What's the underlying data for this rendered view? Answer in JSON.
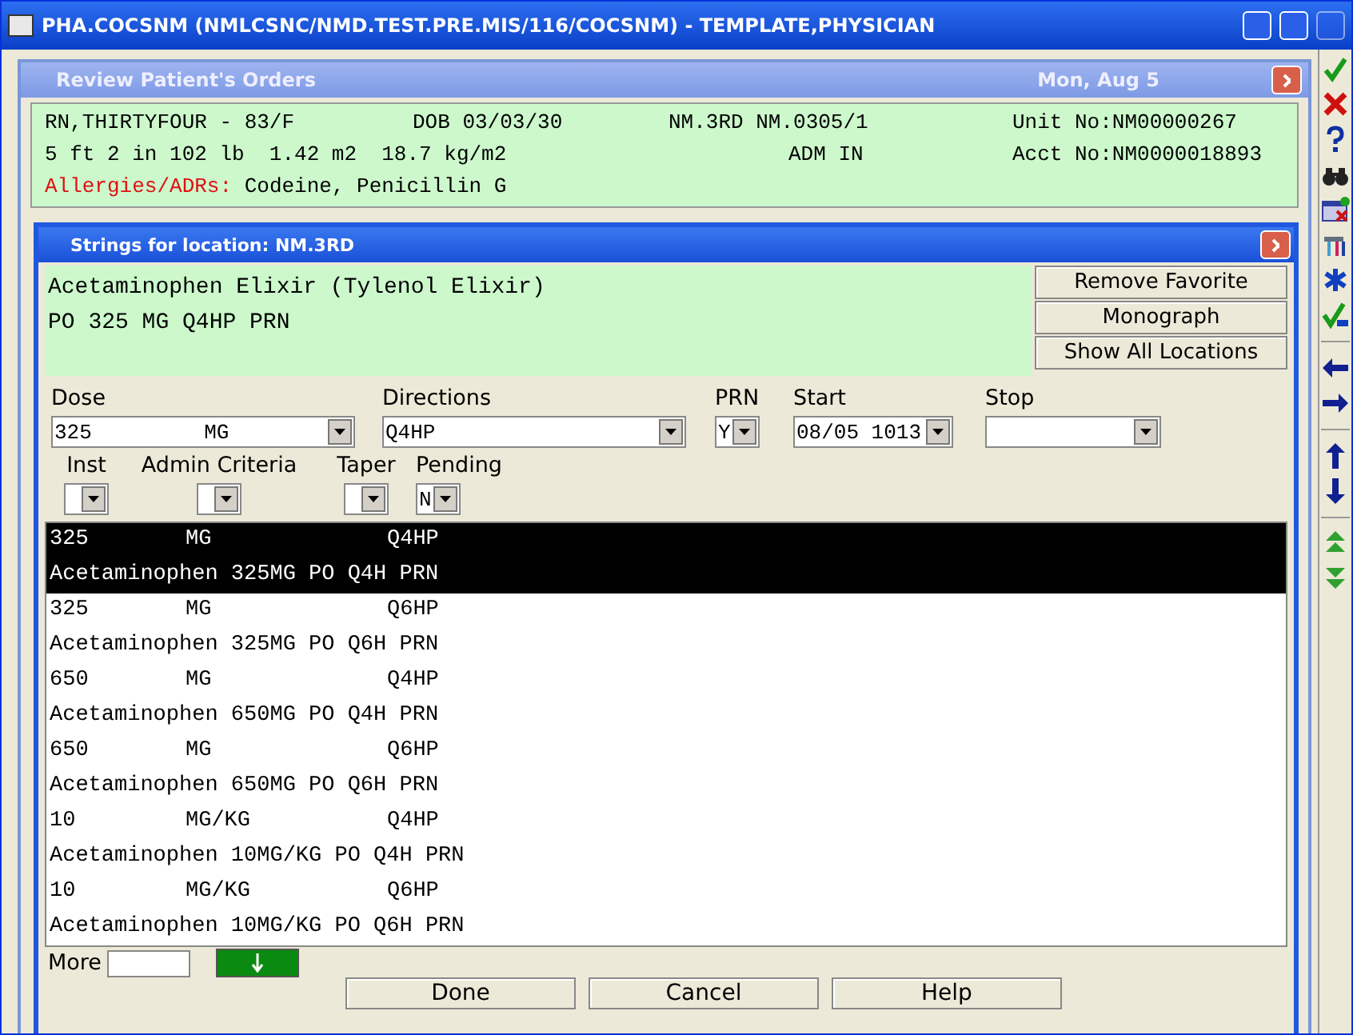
{
  "window": {
    "title": "PHA.COCSNM (NMLCSNC/NMD.TEST.PRE.MIS/116/COCSNM) - TEMPLATE,PHYSICIAN"
  },
  "review": {
    "title": "Review Patient's Orders",
    "date": "Mon, Aug 5",
    "patient": {
      "name": "RN,THIRTYFOUR - 83/F",
      "dob": "DOB 03/03/30",
      "location": "NM.3RD NM.0305/1",
      "unit": "Unit No:NM00000267",
      "measures": "5 ft 2 in 102 lb  1.42 m2  18.7 kg/m2",
      "status": "ADM IN",
      "account": "Acct No:NM0000018893"
    },
    "allergies_label": "Allergies/ADRs:",
    "allergies": "Codeine, Penicillin G"
  },
  "dialog": {
    "title": "Strings for location: NM.3RD",
    "drug_lines": [
      "Acetaminophen Elixir (Tylenol Elixir)",
      "PO 325 MG Q4HP PRN"
    ],
    "side_buttons": [
      "Remove Favorite",
      "Monograph",
      "Show All Locations"
    ],
    "fields_row1": [
      {
        "label": "Dose",
        "value": "325         MG"
      },
      {
        "label": "Directions",
        "value": "Q4HP"
      },
      {
        "label": "PRN",
        "value": "Y"
      },
      {
        "label": "Start",
        "value": "08/05 1013"
      },
      {
        "label": "Stop"
      }
    ],
    "fields_row2": [
      {
        "label": "Inst"
      },
      {
        "label": "Admin Criteria"
      },
      {
        "label": "Taper"
      },
      {
        "label": "Pending",
        "value": "N"
      }
    ],
    "strings": [
      {
        "dose": "325",
        "unit": "MG",
        "directions": "Q4HP",
        "description": "Acetaminophen 325MG PO Q4H PRN",
        "selected": true
      },
      {
        "dose": "325",
        "unit": "MG",
        "directions": "Q6HP",
        "description": "Acetaminophen 325MG PO Q6H PRN",
        "selected": false
      },
      {
        "dose": "650",
        "unit": "MG",
        "directions": "Q4HP",
        "description": "Acetaminophen 650MG PO Q4H PRN",
        "selected": false
      },
      {
        "dose": "650",
        "unit": "MG",
        "directions": "Q6HP",
        "description": "Acetaminophen 650MG PO Q6H PRN",
        "selected": false
      },
      {
        "dose": "10",
        "unit": "MG/KG",
        "directions": "Q4HP",
        "description": "Acetaminophen 10MG/KG PO Q4H PRN",
        "selected": false
      },
      {
        "dose": "10",
        "unit": "MG/KG",
        "directions": "Q6HP",
        "description": "Acetaminophen 10MG/KG PO Q6H PRN",
        "selected": false
      }
    ],
    "more_label": "More",
    "buttons": [
      "Done",
      "Cancel",
      "Help"
    ]
  },
  "toolbar": [
    {
      "kind": "check"
    },
    {
      "kind": "cross"
    },
    {
      "kind": "question"
    },
    {
      "kind": "binoculars"
    },
    {
      "kind": "calendar"
    },
    {
      "kind": "tools"
    },
    {
      "kind": "asterisk"
    },
    {
      "kind": "check-all"
    },
    {
      "kind": "sep"
    },
    {
      "kind": "left"
    },
    {
      "kind": "right"
    },
    {
      "kind": "sep"
    },
    {
      "kind": "up"
    },
    {
      "kind": "down"
    },
    {
      "kind": "sep"
    },
    {
      "kind": "double-up"
    },
    {
      "kind": "double-down"
    }
  ]
}
